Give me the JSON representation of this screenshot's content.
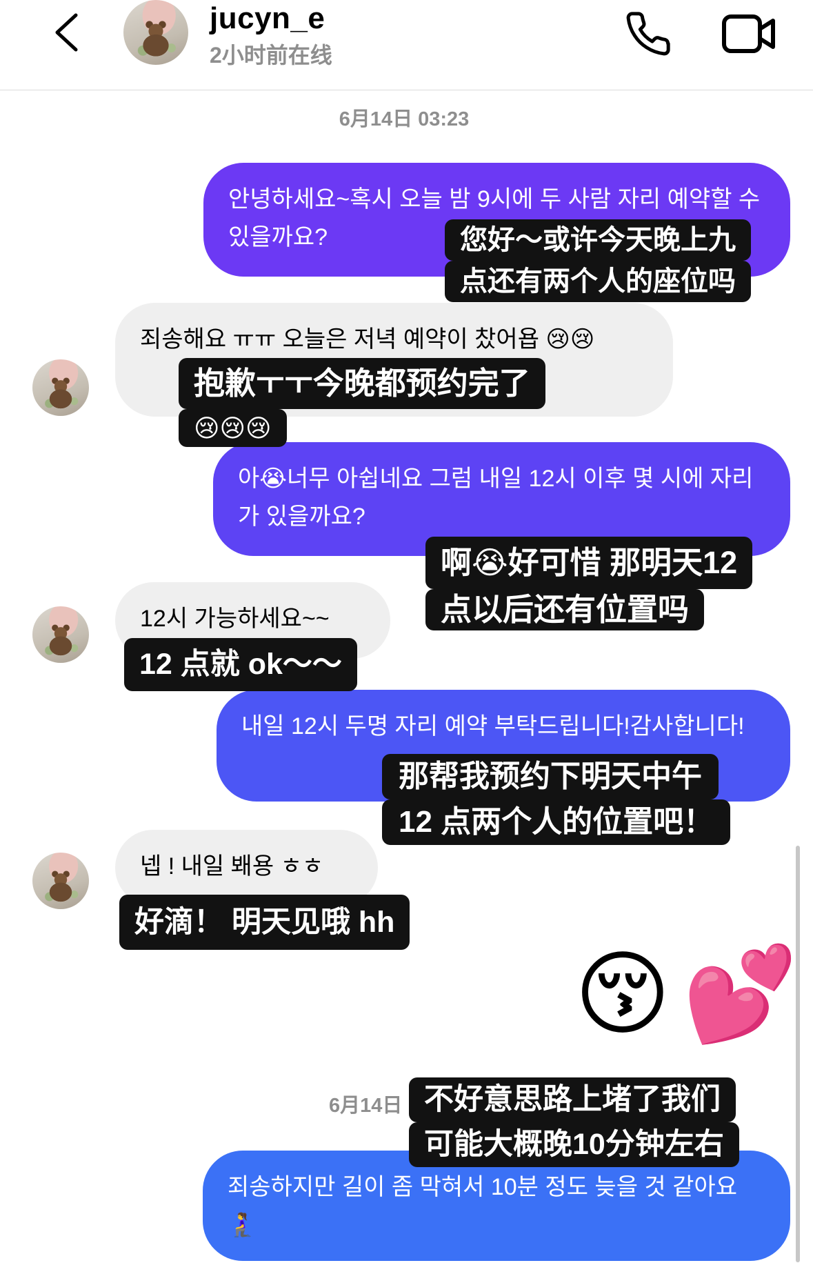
{
  "header": {
    "back_icon": "chevron-left-icon",
    "username": "jucyn_e",
    "status": "2小时前在线",
    "call_icon": "phone-icon",
    "video_icon": "video-camera-icon"
  },
  "thread": {
    "timestamps": [
      "6月14日 03:23",
      "6月14日"
    ],
    "messages": [
      {
        "side": "outgoing",
        "text": "안녕하세요~혹시 오늘 밤 9시에 두 사람 자리 예약할 수 있을까요?",
        "bubble_color": "#6c39f4"
      },
      {
        "side": "incoming",
        "text": "죄송해요 ㅠㅠ 오늘은 저녁 예약이 찼어욥 😢😢",
        "bubble_color": "#efefef"
      },
      {
        "side": "outgoing",
        "text": "아😭너무 아쉽네요  그럼 내일 12시 이후 몇 시에 자리가 있을까요?",
        "bubble_color": "#5d43f4"
      },
      {
        "side": "incoming",
        "text": "12시 가능하세요~~",
        "bubble_color": "#efefef"
      },
      {
        "side": "outgoing",
        "text": "내일 12시 두명 자리 예약 부탁드립니다!감사합니다!",
        "bubble_color": "#4c56f5"
      },
      {
        "side": "incoming",
        "text": "넵 ! 내일 봬용 ㅎㅎ",
        "bubble_color": "#efefef"
      },
      {
        "side": "outgoing",
        "emoji": [
          "😚",
          "💕"
        ]
      },
      {
        "side": "outgoing",
        "text": "죄송하지만 길이 좀 막혀서 10분 정도 늦을 것 같아요 🧎‍♀️",
        "bubble_color": "#3b71f6"
      }
    ]
  },
  "captions": [
    {
      "lines": [
        "您好～或许今天晚上九",
        "点还有两个人的座位吗"
      ]
    },
    {
      "lines": [
        "抱歉ㅜㅜ今晚都预约完了",
        "😢😢😢"
      ]
    },
    {
      "lines": [
        "啊😭好可惜 那明天12",
        "点以后还有位置吗"
      ]
    },
    {
      "lines": [
        "12 点就 ok～～"
      ]
    },
    {
      "lines": [
        "那帮我预约下明天中午",
        "12 点两个人的位置吧！"
      ]
    },
    {
      "lines": [
        "好滴！ 明天见哦 hh"
      ]
    },
    {
      "lines": [
        "不好意思路上堵了我们",
        "可能大概晚10分钟左右"
      ]
    }
  ],
  "theme": {
    "caption_bg": "#121212",
    "divider": "#dbdbdb",
    "muted_text": "#8e8e8e",
    "scrollbar": "#c7c7c7"
  }
}
